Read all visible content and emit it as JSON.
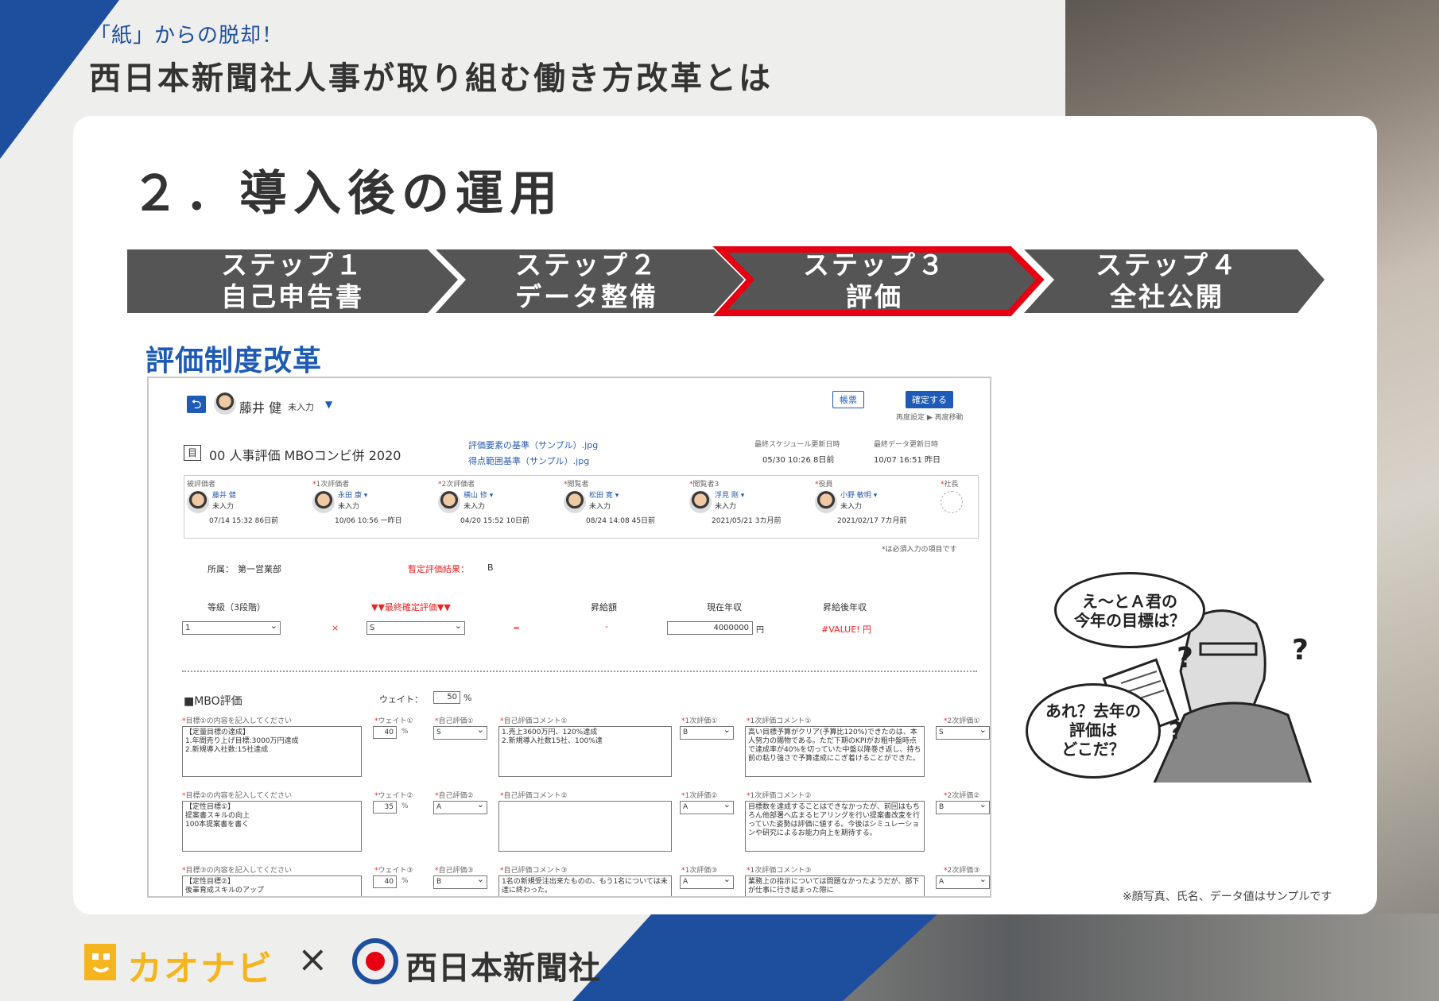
{
  "header": {
    "tagline": "「紙」からの脱却！",
    "title": "西日本新聞社人事が取り組む働き方改革とは"
  },
  "section": {
    "title": "２．導入後の運用",
    "subtitle": "評価制度改革"
  },
  "steps": [
    {
      "line1": "ステップ１",
      "line2": "自己申告書"
    },
    {
      "line1": "ステップ２",
      "line2": "データ整備"
    },
    {
      "line1": "ステップ３",
      "line2": "評価"
    },
    {
      "line1": "ステップ４",
      "line2": "全社公開"
    }
  ],
  "colors": {
    "accent_blue": "#1e4f9e",
    "step_gray": "#555555",
    "highlight_red": "#e60012",
    "logo_yellow": "#f4b51e"
  },
  "screenshot": {
    "user_name": "藤井 健",
    "user_status": "未入力",
    "form_title": "00 人事評価 MBOコンビ併 2020",
    "link1": "評価要素の基準（サンプル）.jpg",
    "link2": "得点範囲基準（サンプル）.jpg",
    "btn_ledger": "帳票",
    "btn_confirm": "確定する",
    "crumbs": "再度設定 ▶ 再度移動",
    "last_update_label1": "最終スケジュール更新日時",
    "last_update_val1": "05/30 10:26 8日前",
    "last_update_label2": "最終データ更新日時",
    "last_update_val2": "10/07 16:51 昨日",
    "evaluators": [
      {
        "role": "被評価者",
        "name": "藤井 健",
        "status": "未入力",
        "date": "07/14 15:32 86日前",
        "required": false
      },
      {
        "role": "1次評価者",
        "name": "永田 康 ▾",
        "status": "未入力",
        "date": "10/06 10:56 一昨日",
        "required": true
      },
      {
        "role": "2次評価者",
        "name": "横山 修 ▾",
        "status": "未入力",
        "date": "04/20 15:52 10日前",
        "required": true
      },
      {
        "role": "閲覧者",
        "name": "松田 寛 ▾",
        "status": "未入力",
        "date": "08/24 14:08 45日前",
        "required": true
      },
      {
        "role": "閲覧者3",
        "name": "浮見 剛 ▾",
        "status": "未入力",
        "date": "2021/05/21 3カ月前",
        "required": true
      },
      {
        "role": "役員",
        "name": "小野 敏明 ▾",
        "status": "未入力",
        "date": "2021/02/17 7カ月前",
        "required": true
      },
      {
        "role": "社長",
        "name": "",
        "status": "",
        "date": "",
        "required": true
      }
    ],
    "required_note": "*は必須入力の項目です",
    "dept_label": "所属：",
    "dept_value": "第一営業部",
    "provisional_label": "暫定評価結果：",
    "provisional_value": "B",
    "grade_label": "等級（3段階）",
    "final_eval_label": "▼▼最終確定評価▼▼",
    "raise_label": "昇給額",
    "salary_label": "現在年収",
    "after_label": "昇給後年収",
    "grade_value": "1",
    "times_sign": "×",
    "final_eval_value": "S",
    "equals_sign": "=",
    "raise_value": "-",
    "salary_value": "4000000",
    "yen": "円",
    "after_value": "#VALUE! 円",
    "mbo_title": "■MBO評価",
    "weight_label": "ウェイト：",
    "weight_value": "50",
    "percent": "%",
    "headers": [
      "目標①の内容を記入してください",
      "ウェイト①",
      "自己評価①",
      "自己評価コメント①",
      "1次評価①",
      "1次評価コメント①",
      "2次評価①"
    ],
    "headers2": [
      "目標②の内容を記入してください",
      "ウェイト②",
      "自己評価②",
      "自己評価コメント②",
      "1次評価②",
      "1次評価コメント②",
      "2次評価②"
    ],
    "headers3": [
      "目標③の内容を記入してください",
      "ウェイト③",
      "自己評価③",
      "自己評価コメント③",
      "1次評価③",
      "1次評価コメント③",
      "2次評価③"
    ],
    "rows": [
      {
        "goal": "【定量目標の達成】\n1.年間売り上げ目標:3000万円達成\n2.新規導入社数:15社達成",
        "weight": "40",
        "self": "S",
        "self_comment": "1.売上3600万円、120%達成\n2.新規導入社数15社、100%達",
        "first": "B",
        "first_comment": "高い目標予算がクリア(予算比120%)できたのは、本人努力の賜物である。ただ下期のKPIがお粗中盤時点で達成率が40%を切っていた中盤以降巻き返し、持ち前の粘り強さで予算達成にこぎ着けることができた。",
        "second": "S"
      },
      {
        "goal": "【定性目標①】\n提案書スキルの向上\n100本提案書を書く",
        "weight": "35",
        "self": "A",
        "self_comment": "",
        "first": "A",
        "first_comment": "目標数を達成することはできなかったが、前回はもちろん他部署へ広まるヒアリングを行い提案書改変を行っていた姿勢は評価に値する。今後はシミュレーションや研究によるお能力向上を期待する。",
        "second": "B"
      },
      {
        "goal": "【定性目標②】\n後輩育成スキルのアップ",
        "weight": "40",
        "self": "B",
        "self_comment": "1名の新規受注出来たものの、もう1名については未達に終わった。",
        "first": "A",
        "first_comment": "業務上の指示については問題なかったようだが、部下が仕事に行き詰まった際に",
        "second": "A"
      }
    ]
  },
  "cartoon": {
    "bubble1": "え〜とＡ君の\n今年の目標は？",
    "bubble2": "あれ？去年の\n評価は\nどこだ？"
  },
  "footnote": "※顔写真、氏名、データ値はサンプルです",
  "footer": {
    "logo1": "カオナビ",
    "times": "×",
    "logo2": "西日本新聞社"
  }
}
